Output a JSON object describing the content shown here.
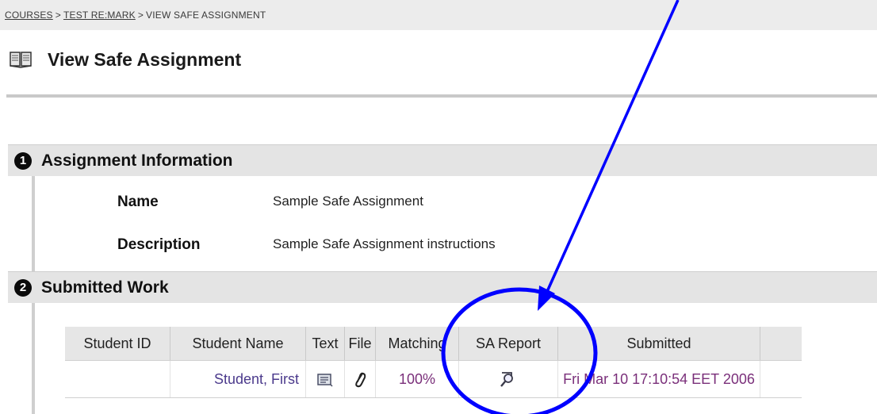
{
  "breadcrumb": {
    "items": [
      "COURSES",
      "TEST RE:MARK"
    ],
    "separator": ">",
    "current": "VIEW SAFE ASSIGNMENT"
  },
  "header": {
    "icon": "book-icon",
    "title": "View Safe Assignment"
  },
  "steps": [
    {
      "number": "1",
      "title": "Assignment Information"
    },
    {
      "number": "2",
      "title": "Submitted Work"
    }
  ],
  "assignment": {
    "name_label": "Name",
    "name_value": "Sample Safe Assignment",
    "description_label": "Description",
    "description_value": "Sample Safe Assignment instructions"
  },
  "table": {
    "columns": [
      "Student ID",
      "Student Name",
      "Text",
      "File",
      "Matching",
      "SA Report",
      "Submitted"
    ],
    "rows": [
      {
        "student_id": "",
        "student_name": "Student, First",
        "text_icon": "document-icon",
        "file_icon": "paperclip-icon",
        "matching": "100%",
        "sa_report_icon": "magnifier-report-icon",
        "submitted": "Fri Mar 10 17:10:54 EET 2006"
      }
    ]
  },
  "colors": {
    "annotation": "#0000ff",
    "link_text": "#4b3a8c",
    "header_bg": "#e4e4e4"
  }
}
